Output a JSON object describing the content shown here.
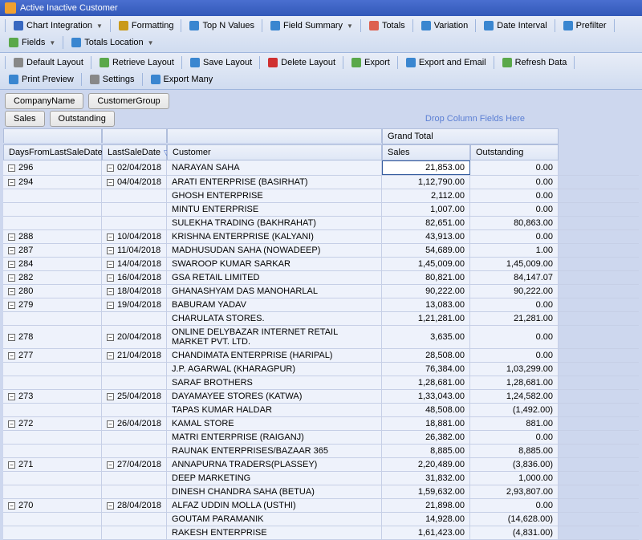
{
  "title": "Active Inactive Customer",
  "toolbar1": [
    {
      "label": "Chart Integration",
      "dd": true,
      "color": "#3868c0"
    },
    {
      "label": "Formatting",
      "color": "#c99a1a"
    },
    {
      "label": "Top N Values",
      "color": "#3a86d0"
    },
    {
      "label": "Field Summary",
      "dd": true,
      "color": "#3a86d0"
    },
    {
      "label": "Totals",
      "color": "#dd6050"
    },
    {
      "label": "Variation",
      "color": "#3a86d0"
    },
    {
      "label": "Date Interval",
      "color": "#3a86d0"
    },
    {
      "label": "Prefilter",
      "color": "#3a86d0"
    },
    {
      "label": "Fields",
      "dd": true,
      "color": "#5aa84a"
    },
    {
      "label": "Totals Location",
      "dd": true,
      "color": "#3a86d0"
    }
  ],
  "toolbar2": [
    {
      "label": "Default Layout",
      "color": "#888888"
    },
    {
      "label": "Retrieve Layout",
      "color": "#5aa84a"
    },
    {
      "label": "Save Layout",
      "color": "#3a86d0"
    },
    {
      "label": "Delete Layout",
      "color": "#d03030"
    },
    {
      "label": "Export",
      "color": "#5aa84a"
    },
    {
      "label": "Export and Email",
      "color": "#3a86d0"
    },
    {
      "label": "Refresh Data",
      "color": "#5aa84a"
    },
    {
      "label": "Print Preview",
      "color": "#3a86d0"
    },
    {
      "label": "Settings",
      "color": "#888888"
    },
    {
      "label": "Export Many",
      "color": "#3a86d0"
    }
  ],
  "pills": [
    "CompanyName",
    "CustomerGroup"
  ],
  "tabs": [
    "Sales",
    "Outstanding"
  ],
  "drop_hint": "Drop Column Fields Here",
  "grand_total": "Grand Total",
  "headers": {
    "days": "DaysFromLastSaleDate",
    "date": "LastSaleDate",
    "customer": "Customer",
    "sales": "Sales",
    "outstanding": "Outstanding"
  },
  "rows": [
    {
      "days": "296",
      "date": "02/04/2018",
      "cust": "NARAYAN SAHA",
      "sales": "21,853.00",
      "out": "0.00",
      "sel": true
    },
    {
      "days": "294",
      "date": "04/04/2018",
      "cust": "ARATI ENTERPRISE (BASIRHAT)",
      "sales": "1,12,790.00",
      "out": "0.00"
    },
    {
      "days": "",
      "date": "",
      "cust": "GHOSH ENTERPRISE",
      "sales": "2,112.00",
      "out": "0.00"
    },
    {
      "days": "",
      "date": "",
      "cust": "MINTU ENTERPRISE",
      "sales": "1,007.00",
      "out": "0.00"
    },
    {
      "days": "",
      "date": "",
      "cust": "SULEKHA TRADING (BAKHRAHAT)",
      "sales": "82,651.00",
      "out": "80,863.00"
    },
    {
      "days": "288",
      "date": "10/04/2018",
      "cust": "KRISHNA ENTERPRISE (KALYANI)",
      "sales": "43,913.00",
      "out": "0.00"
    },
    {
      "days": "287",
      "date": "11/04/2018",
      "cust": "MADHUSUDAN SAHA (NOWADEEP)",
      "sales": "54,689.00",
      "out": "1.00"
    },
    {
      "days": "284",
      "date": "14/04/2018",
      "cust": "SWAROOP KUMAR SARKAR",
      "sales": "1,45,009.00",
      "out": "1,45,009.00"
    },
    {
      "days": "282",
      "date": "16/04/2018",
      "cust": "GSA RETAIL LIMITED",
      "sales": "80,821.00",
      "out": "84,147.07"
    },
    {
      "days": "280",
      "date": "18/04/2018",
      "cust": "GHANASHYAM DAS MANOHARLAL",
      "sales": "90,222.00",
      "out": "90,222.00"
    },
    {
      "days": "279",
      "date": "19/04/2018",
      "cust": "BABURAM YADAV",
      "sales": "13,083.00",
      "out": "0.00"
    },
    {
      "days": "",
      "date": "",
      "cust": "CHARULATA STORES.",
      "sales": "1,21,281.00",
      "out": "21,281.00"
    },
    {
      "days": "278",
      "date": "20/04/2018",
      "cust": "ONLINE DELYBAZAR INTERNET RETAIL MARKET PVT. LTD.",
      "sales": "3,635.00",
      "out": "0.00"
    },
    {
      "days": "277",
      "date": "21/04/2018",
      "cust": "CHANDIMATA ENTERPRISE (HARIPAL)",
      "sales": "28,508.00",
      "out": "0.00"
    },
    {
      "days": "",
      "date": "",
      "cust": "J.P. AGARWAL (KHARAGPUR)",
      "sales": "76,384.00",
      "out": "1,03,299.00"
    },
    {
      "days": "",
      "date": "",
      "cust": "SARAF BROTHERS",
      "sales": "1,28,681.00",
      "out": "1,28,681.00"
    },
    {
      "days": "273",
      "date": "25/04/2018",
      "cust": "DAYAMAYEE STORES (KATWA)",
      "sales": "1,33,043.00",
      "out": "1,24,582.00"
    },
    {
      "days": "",
      "date": "",
      "cust": "TAPAS KUMAR HALDAR",
      "sales": "48,508.00",
      "out": "(1,492.00)"
    },
    {
      "days": "272",
      "date": "26/04/2018",
      "cust": "KAMAL STORE",
      "sales": "18,881.00",
      "out": "881.00"
    },
    {
      "days": "",
      "date": "",
      "cust": "MATRI ENTERPRISE (RAIGANJ)",
      "sales": "26,382.00",
      "out": "0.00"
    },
    {
      "days": "",
      "date": "",
      "cust": "RAUNAK ENTERPRISES/BAZAAR 365",
      "sales": "8,885.00",
      "out": "8,885.00"
    },
    {
      "days": "271",
      "date": "27/04/2018",
      "cust": "ANNAPURNA TRADERS(PLASSEY)",
      "sales": "2,20,489.00",
      "out": "(3,836.00)"
    },
    {
      "days": "",
      "date": "",
      "cust": "DEEP MARKETING",
      "sales": "31,832.00",
      "out": "1,000.00"
    },
    {
      "days": "",
      "date": "",
      "cust": "DINESH CHANDRA SAHA (BETUA)",
      "sales": "1,59,632.00",
      "out": "2,93,807.00"
    },
    {
      "days": "270",
      "date": "28/04/2018",
      "cust": "ALFAZ UDDIN MOLLA (USTHI)",
      "sales": "21,898.00",
      "out": "0.00"
    },
    {
      "days": "",
      "date": "",
      "cust": "GOUTAM PARAMANIK",
      "sales": "14,928.00",
      "out": "(14,628.00)"
    },
    {
      "days": "",
      "date": "",
      "cust": "RAKESH ENTERPRISE",
      "sales": "1,61,423.00",
      "out": "(4,831.00)"
    }
  ]
}
